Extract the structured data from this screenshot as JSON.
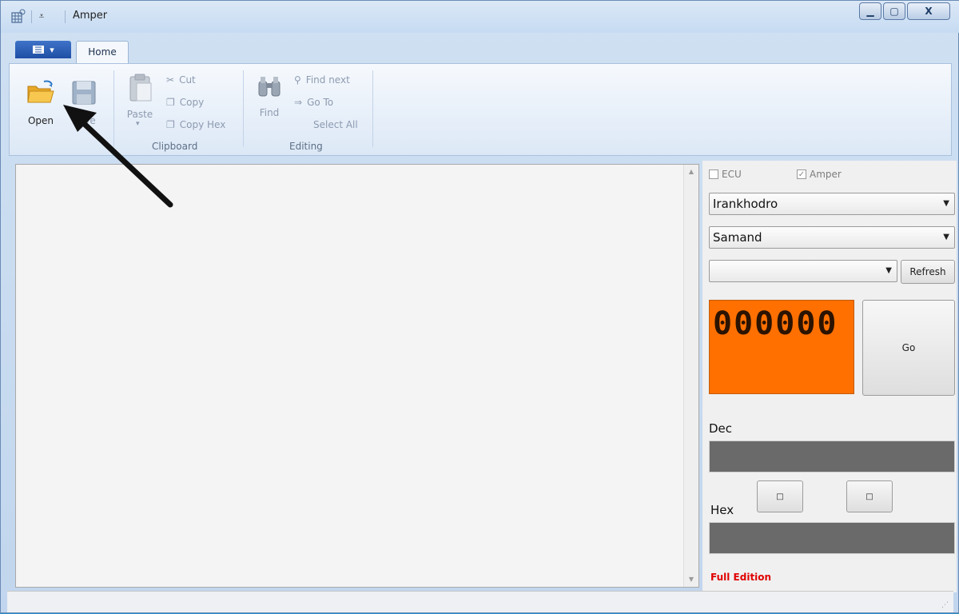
{
  "window": {
    "title": "Amper"
  },
  "quick_access": {
    "icon": "save-quick-icon"
  },
  "ribbon": {
    "app_menu_icon": "app-menu-icon",
    "tabs": [
      {
        "label": "Home"
      }
    ],
    "groups": {
      "file": {
        "open_label": "Open",
        "save_label": "Save"
      },
      "clipboard": {
        "label": "Clipboard",
        "paste_label": "Paste",
        "cut_label": "Cut",
        "copy_label": "Copy",
        "copy_hex_label": "Copy Hex"
      },
      "editing": {
        "label": "Editing",
        "find_label": "Find",
        "find_next_label": "Find next",
        "goto_label": "Go To",
        "select_all_label": "Select All"
      }
    }
  },
  "side_panel": {
    "ecu_label": "ECU",
    "ecu_checked": false,
    "amper_label": "Amper",
    "amper_checked": true,
    "manufacturer": "Irankhodro",
    "model": "Samand",
    "port": "",
    "refresh_label": "Refresh",
    "counter_display": "000000",
    "go_label": "Go",
    "dec_label": "Dec",
    "hex_label": "Hex",
    "small_button_1": "□",
    "small_button_2": "□",
    "edition": "Full Edition"
  },
  "colors": {
    "lcd": "#ff7000",
    "edition": "#e00000"
  }
}
